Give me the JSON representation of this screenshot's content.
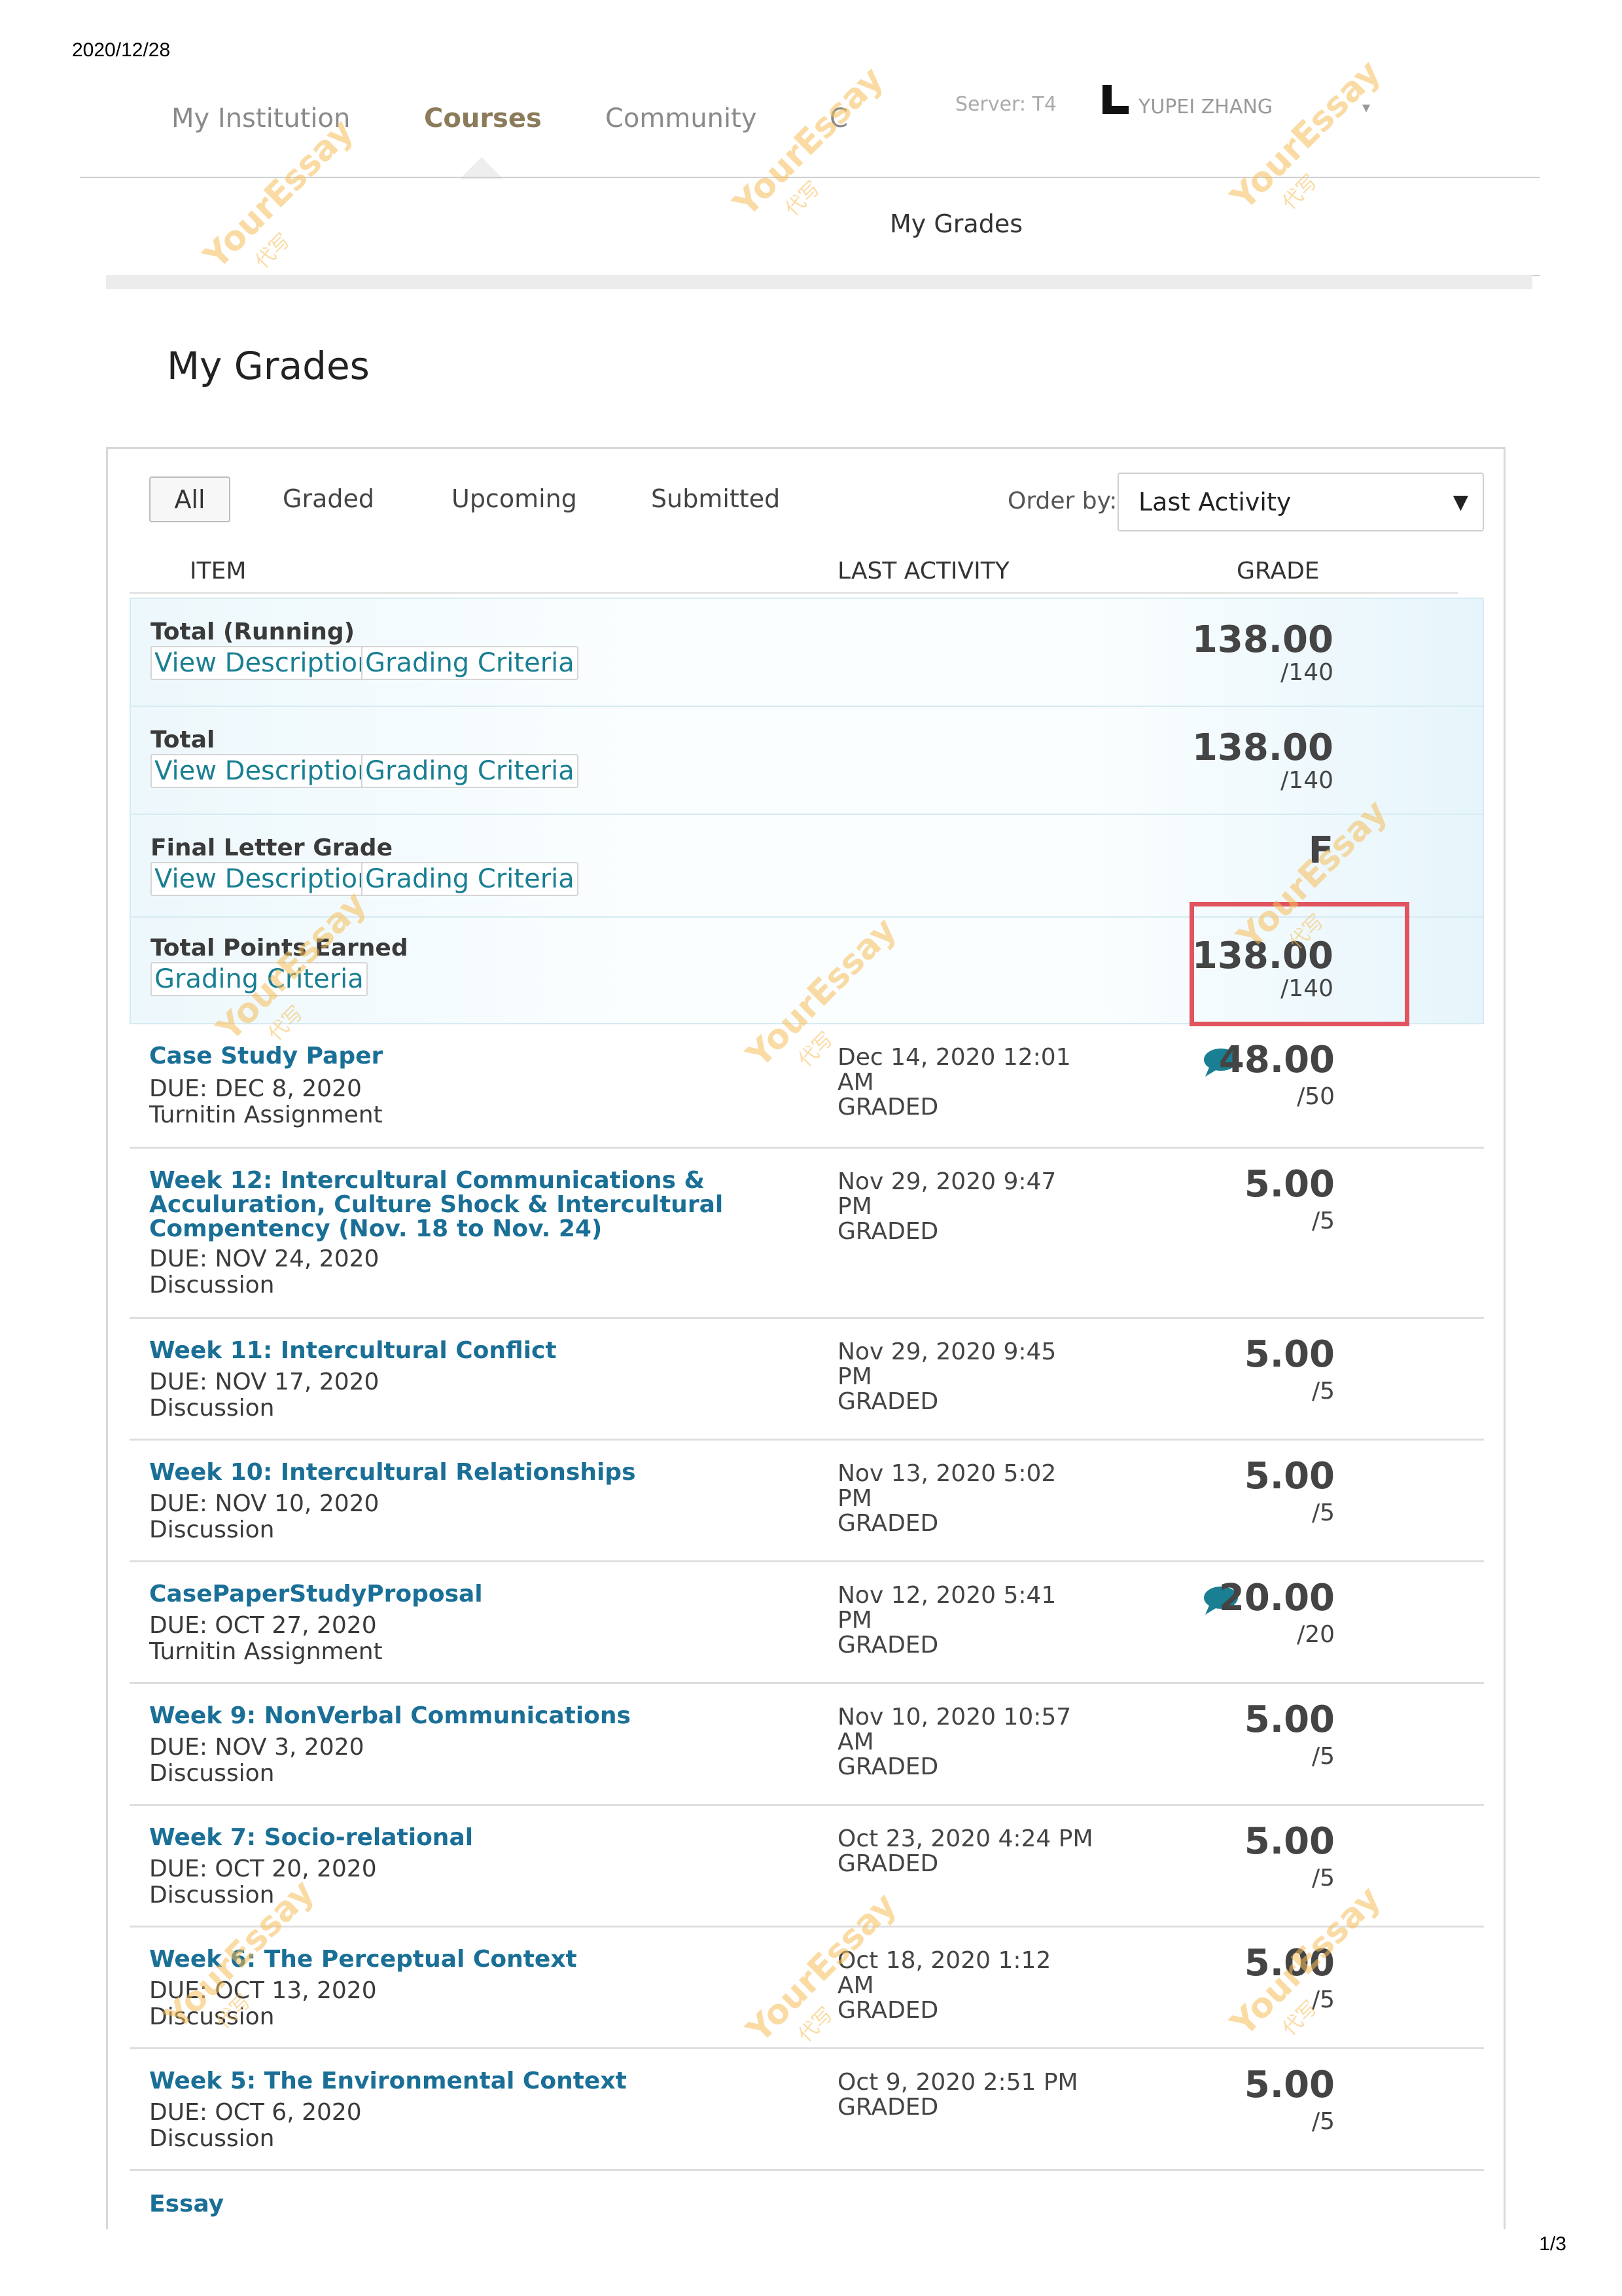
{
  "print": {
    "date": "2020/12/28",
    "page": "1/3"
  },
  "nav": {
    "items": [
      "My Institution",
      "Courses",
      "Community",
      "C"
    ],
    "server": "Server: T4",
    "user_name": "YUPEI ZHANG"
  },
  "breadcrumb": "My Grades",
  "page_title": "My Grades",
  "filters": [
    "All",
    "Graded",
    "Upcoming",
    "Submitted"
  ],
  "order": {
    "label": "Order by:",
    "value": "Last Activity"
  },
  "columns": {
    "item": "ITEM",
    "activity": "LAST ACTIVITY",
    "grade": "GRADE"
  },
  "totals": [
    {
      "title": "Total (Running)",
      "links": [
        "View Description",
        "Grading Criteria"
      ],
      "score": "138.00",
      "out_of": "/140"
    },
    {
      "title": "Total",
      "links": [
        "View Description",
        "Grading Criteria"
      ],
      "score": "138.00",
      "out_of": "/140"
    },
    {
      "title": "Final Letter Grade",
      "links": [
        "View Description",
        "Grading Criteria"
      ],
      "score": "F",
      "out_of": ""
    },
    {
      "title": "Total Points Earned",
      "links": [
        "Grading Criteria"
      ],
      "score": "138.00",
      "out_of": "/140"
    }
  ],
  "items": [
    {
      "title": [
        "Case Study Paper"
      ],
      "due": "DUE: DEC 8, 2020",
      "type": "Turnitin Assignment",
      "activity": [
        "Dec 14, 2020 12:01",
        "AM",
        "GRADED"
      ],
      "score": "48.00",
      "out_of": "/50",
      "has_comment": true
    },
    {
      "title": [
        "Week 12: Intercultural Communications &",
        "Acculuration, Culture Shock & Intercultural",
        "Compentency (Nov. 18 to Nov. 24)"
      ],
      "due": "DUE: NOV 24, 2020",
      "type": "Discussion",
      "activity": [
        "Nov 29, 2020 9:47",
        "PM",
        "GRADED"
      ],
      "score": "5.00",
      "out_of": "/5",
      "has_comment": false
    },
    {
      "title": [
        "Week 11: Intercultural Conflict"
      ],
      "due": "DUE: NOV 17, 2020",
      "type": "Discussion",
      "activity": [
        "Nov 29, 2020 9:45",
        "PM",
        "GRADED"
      ],
      "score": "5.00",
      "out_of": "/5",
      "has_comment": false
    },
    {
      "title": [
        "Week 10: Intercultural Relationships"
      ],
      "due": "DUE: NOV 10, 2020",
      "type": "Discussion",
      "activity": [
        "Nov 13, 2020 5:02",
        "PM",
        "GRADED"
      ],
      "score": "5.00",
      "out_of": "/5",
      "has_comment": false
    },
    {
      "title": [
        "CasePaperStudyProposal"
      ],
      "due": "DUE: OCT 27, 2020",
      "type": "Turnitin Assignment",
      "activity": [
        "Nov 12, 2020 5:41",
        "PM",
        "GRADED"
      ],
      "score": "20.00",
      "out_of": "/20",
      "has_comment": true
    },
    {
      "title": [
        "Week 9: NonVerbal Communications"
      ],
      "due": "DUE: NOV 3, 2020",
      "type": "Discussion",
      "activity": [
        "Nov 10, 2020 10:57",
        "AM",
        "GRADED"
      ],
      "score": "5.00",
      "out_of": "/5",
      "has_comment": false
    },
    {
      "title": [
        "Week 7: Socio-relational"
      ],
      "due": "DUE: OCT 20, 2020",
      "type": "Discussion",
      "activity": [
        "Oct 23, 2020 4:24 PM",
        "GRADED"
      ],
      "score": "5.00",
      "out_of": "/5",
      "has_comment": false
    },
    {
      "title": [
        "Week 6: The Perceptual Context"
      ],
      "due": "DUE: OCT 13, 2020",
      "type": "Discussion",
      "activity": [
        "Oct 18, 2020 1:12",
        "AM",
        "GRADED"
      ],
      "score": "5.00",
      "out_of": "/5",
      "has_comment": false
    },
    {
      "title": [
        "Week 5: The Environmental Context"
      ],
      "due": "DUE: OCT 6, 2020",
      "type": "Discussion",
      "activity": [
        "Oct 9, 2020 2:51 PM",
        "GRADED"
      ],
      "score": "5.00",
      "out_of": "/5",
      "has_comment": false
    },
    {
      "title": [
        "Essay"
      ],
      "due": "",
      "type": "",
      "activity": [],
      "score": "",
      "out_of": "",
      "has_comment": false
    }
  ],
  "watermark": {
    "brand": "YourEssay",
    "sub": "代写"
  },
  "colors": {
    "link": "#1a6f96",
    "highlight": "#e0535f",
    "comment": "#1a7f93"
  }
}
